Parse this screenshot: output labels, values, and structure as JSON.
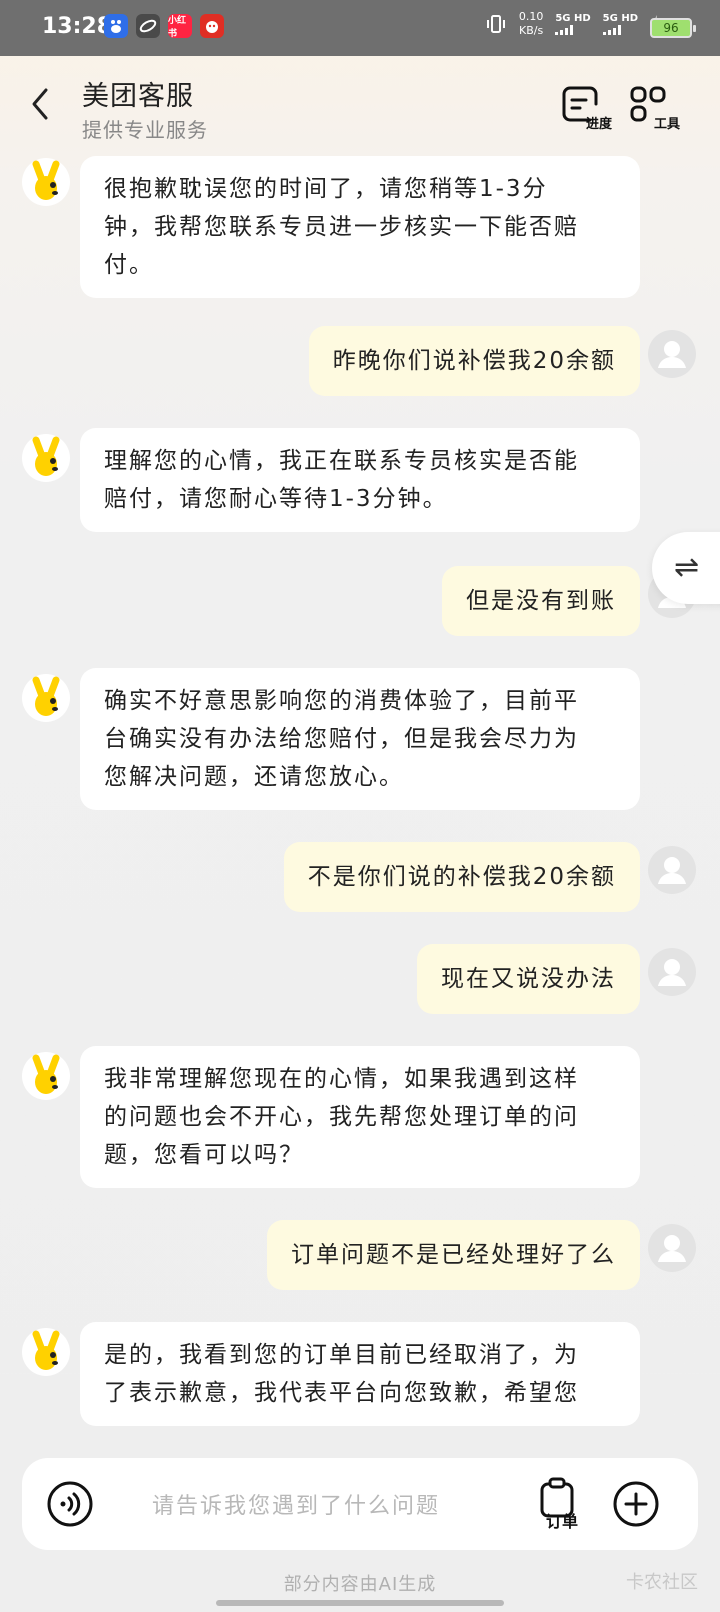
{
  "status_bar": {
    "time": "13:28",
    "net_speed_value": "0.10",
    "net_speed_unit": "KB/s",
    "sim1": "5G HD",
    "sim2": "5G HD",
    "battery": "96",
    "app_icons": [
      "baidu-icon",
      "browser-icon",
      "xiaohongshu-icon",
      "pinduoduo-icon"
    ]
  },
  "header": {
    "title": "美团客服",
    "subtitle": "提供专业服务",
    "progress_label": "进度",
    "tools_label": "工具"
  },
  "messages": [
    {
      "from": "bot",
      "text_lines": [
        "很抱歉耽误您的时间了，请您稍等1-3分",
        "钟，我帮您联系专员进一步核实一下能否赔",
        "付。"
      ]
    },
    {
      "from": "user",
      "text": "昨晚你们说补偿我20余额"
    },
    {
      "from": "bot",
      "text_lines": [
        "理解您的心情，我正在联系专员核实是否能",
        "赔付，请您耐心等待1-3分钟。"
      ]
    },
    {
      "from": "user",
      "text": "但是没有到账"
    },
    {
      "from": "bot",
      "text_lines": [
        "确实不好意思影响您的消费体验了，目前平",
        "台确实没有办法给您赔付，但是我会尽力为",
        "您解决问题，还请您放心。"
      ]
    },
    {
      "from": "user",
      "text": "不是你们说的补偿我20余额"
    },
    {
      "from": "user",
      "text": "现在又说没办法"
    },
    {
      "from": "bot",
      "text_lines": [
        "我非常理解您现在的心情，如果我遇到这样",
        "的问题也会不开心，我先帮您处理订单的问",
        "题，您看可以吗？"
      ]
    },
    {
      "from": "user",
      "text": "订单问题不是已经处理好了么"
    },
    {
      "from": "bot",
      "text_lines": [
        "是的，我看到您的订单目前已经取消了，为",
        "了表示歉意，我代表平台向您致歉，希望您"
      ]
    }
  ],
  "side_button": {
    "glyph": "⇌"
  },
  "input": {
    "placeholder": "请告诉我您遇到了什么问题",
    "order_label": "订单"
  },
  "footer": {
    "ai_note": "部分内容由AI生成",
    "watermark": "卡农社区"
  },
  "colors": {
    "user_bubble": "#fefae0",
    "bot_bubble": "#ffffff",
    "brand_yellow": "#ffd100"
  }
}
